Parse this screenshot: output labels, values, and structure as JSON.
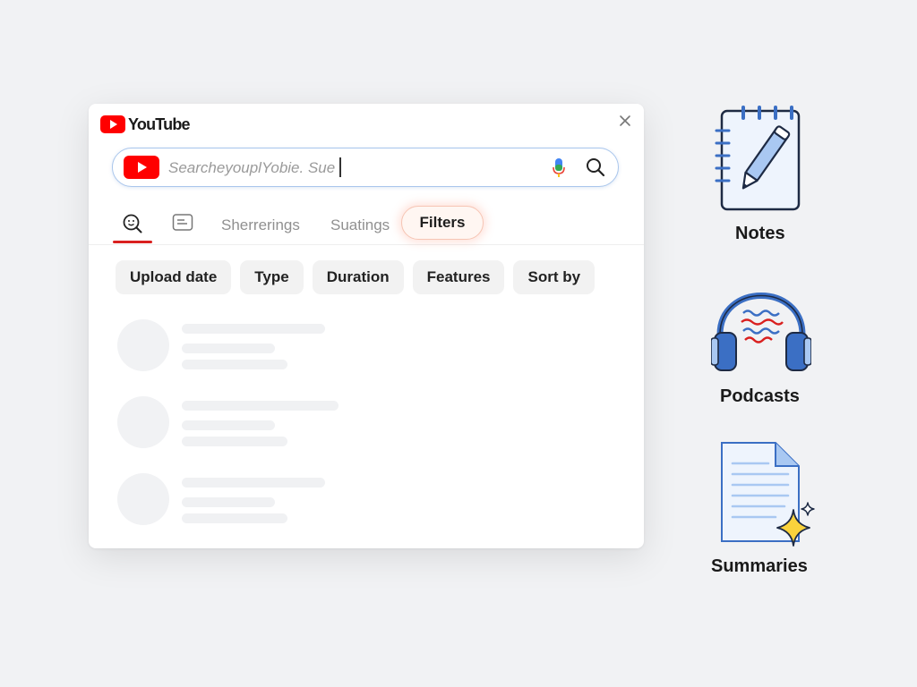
{
  "app": {
    "brand_name": "YouTube"
  },
  "search": {
    "text": "SearcheyouplYobie. Sue"
  },
  "tabs": [
    {
      "label": "Sherrerings"
    },
    {
      "label": "Suatings"
    },
    {
      "label": "Filters"
    }
  ],
  "chips": [
    "Upload date",
    "Type",
    "Duration",
    "Features",
    "Sort by"
  ],
  "side_items": [
    {
      "label": "Notes",
      "icon": "notebook-pencil-icon"
    },
    {
      "label": "Podcasts",
      "icon": "headphones-icon"
    },
    {
      "label": "Summaries",
      "icon": "document-sparkle-icon"
    }
  ],
  "colors": {
    "brand_red": "#ff0000",
    "accent_blue": "#3b6fc4",
    "tab_underline": "#d9201f"
  }
}
